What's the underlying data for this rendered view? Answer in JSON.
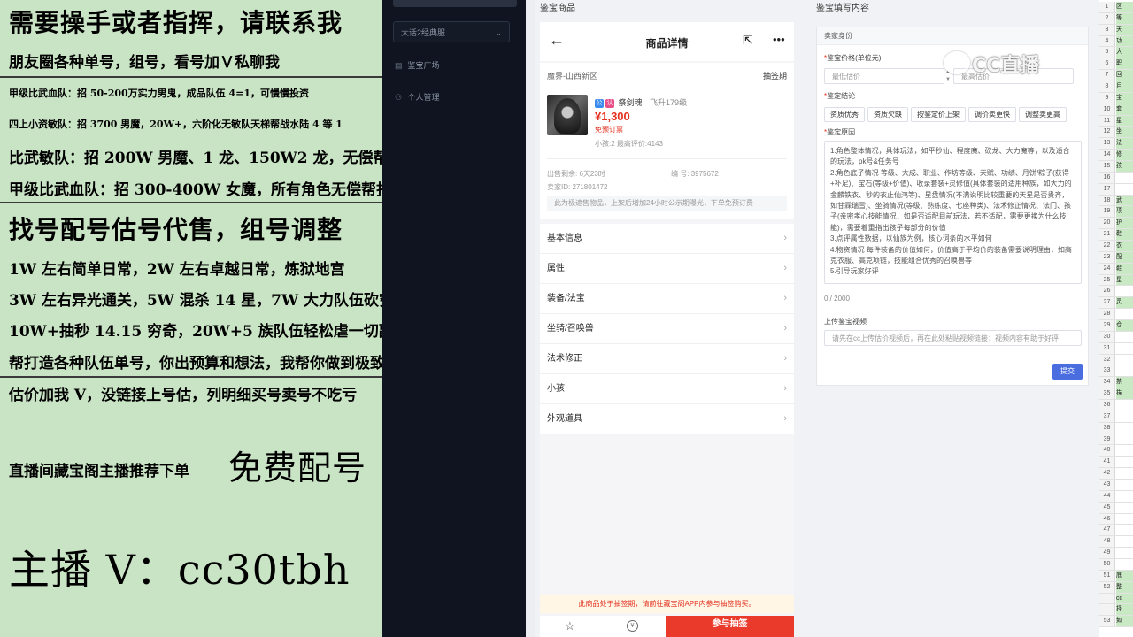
{
  "overlay": {
    "line1": "需要操手或者指挥，请联系我",
    "line2": "朋友圈各种单号，组号，看号加Ｖ私聊我",
    "line3": "甲级比武血队：招 50-200万实力男鬼，成品队伍 4=1，可慢慢投资",
    "line4": "四上小资敏队：招 3700 男魔，20W+，六阶化无敏队天梯帮战水陆 4 等 1",
    "line5": "比武敏队：招 200W 男魔、1 龙、150W2 龙，无偿帮打造",
    "line6": "甲级比武血队：招 300-400W 女魔，所有角色无偿帮打造",
    "line7": "找号配号估号代售，组号调整",
    "line8": "1W 左右简单日常，2W 左右卓越日常，炼狱地宫",
    "line9": "3W 左右异光通关，5W 混杀 14 星，7W 大力队伍砍穷奇",
    "line10": "10W+抽秒 14.15 穷奇，20W+5 族队伍轻松虐一切副本！",
    "line11": "帮打造各种队伍单号，你出预算和想法，我帮你做到极致",
    "line12": "估价加我 V，没链接上号估，列明细买号卖号不吃亏",
    "line13a": "直播间藏宝阁主播推荐下单",
    "line13b": "免费配号",
    "line14": "主播 V：cc30tbh"
  },
  "sidebar": {
    "select_value": "大话2经典服",
    "nav": [
      {
        "icon": "list-icon",
        "label": "鉴宝广场"
      },
      {
        "icon": "user-icon",
        "label": "个人管理"
      }
    ]
  },
  "phone_panel": {
    "title": "鉴宝商品",
    "header_title": "商品详情",
    "server": "魔界-山西新区",
    "lottery_tag": "抽签期",
    "badge1": "公",
    "badge2": "认",
    "char_name": "祭剑魂",
    "char_level": "飞升179级",
    "price": "¥1,300",
    "free_reserve": "免预订票",
    "stats": "小孩:2 最高评价:4143",
    "remain": "出售剩余: 6天23时",
    "serial": "编 号: 3975672",
    "seller": "卖家ID: 271801472",
    "notice": "此为极速售物品，上架后增加24小时公示期曝光，下单免预订费",
    "menu": [
      "基本信息",
      "属性",
      "装备/法宝",
      "坐骑/召唤兽",
      "法术修正",
      "小孩",
      "外观道具"
    ],
    "bottom_notice": "此商品处于抽签期，请前往藏宝阁APP内参与抽签购买。",
    "coin_glyph": "¥",
    "join_label": "参与抽签"
  },
  "form_panel": {
    "title": "鉴宝填写内容",
    "section": "卖家身份",
    "price_label": "鉴宝价格(单位元)",
    "price_min_placeholder": "最低估价",
    "price_max_placeholder": "最高估价",
    "conclusion_label": "鉴定结论",
    "tags": [
      "资质优秀",
      "资质欠缺",
      "按鉴定价上架",
      "调价卖更快",
      "调整卖更高"
    ],
    "reason_label": "鉴定原因",
    "reason_lines": [
      "1.角色整体情况，具体玩法，如平秒仙、程度魔、砍龙、大力魔等，以及适合的玩法，pk号&任务号",
      "2.角色底子情况 等级、大成、职业、作坊等级、天赋、功绩、月饼/粽子(获得+补足)、宝石(等级+价值)、收录套装+灵修值(具体套装的适用种族，如大力的金麟铁衣、秒的衣止仙鸿等)、星盘情况(不满说明比较重要的天星是否贵齐，如甘霖瑞雪)、坐骑情况(等级、熟练度、七座种类)、法术修正情况、法门、孩子(亲密孝心技能情况，如是否适配目前玩法，若不适配，需要更换为什么技能)，需要着重指出孩子每部分的价值",
      "3.点评属性数据，以仙族为例，核心词条的水平如何",
      "4.物资情况 每件装备的价值如何，价值高于平均价的装备需要说明理由，如高克衣服、高克项链，技能组合优秀的召唤兽等",
      "5.引导玩家好评"
    ],
    "counter": "0 / 2000",
    "video_label": "上传鉴宝视频",
    "video_placeholder": "请先在cc上传估价视频后，再在此处粘贴视频链接；视频内容有助于好评",
    "submit": "提交"
  },
  "watermark": "CC直播",
  "sheet": {
    "rows": [
      {
        "n": "1",
        "t": "区"
      },
      {
        "n": "2",
        "t": "等"
      },
      {
        "n": "3",
        "t": "天"
      },
      {
        "n": "4",
        "t": "功"
      },
      {
        "n": "5",
        "t": "大"
      },
      {
        "n": "6",
        "t": "职"
      },
      {
        "n": "7",
        "t": "回"
      },
      {
        "n": "8",
        "t": "月"
      },
      {
        "n": "9",
        "t": "宝"
      },
      {
        "n": "10",
        "t": "套"
      },
      {
        "n": "11",
        "t": "星"
      },
      {
        "n": "12",
        "t": "坐"
      },
      {
        "n": "13",
        "t": "法"
      },
      {
        "n": "14",
        "t": "修"
      },
      {
        "n": "15",
        "t": "孩"
      },
      {
        "n": "16",
        "t": ""
      },
      {
        "n": "17",
        "t": ""
      },
      {
        "n": "18",
        "t": "武"
      },
      {
        "n": "19",
        "t": "项"
      },
      {
        "n": "20",
        "t": "护"
      },
      {
        "n": "21",
        "t": "鞋"
      },
      {
        "n": "22",
        "t": "衣"
      },
      {
        "n": "23",
        "t": "配"
      },
      {
        "n": "24",
        "t": "鞋"
      },
      {
        "n": "25",
        "t": "星"
      },
      {
        "n": "26",
        "t": ""
      },
      {
        "n": "27",
        "t": "灵"
      },
      {
        "n": "28",
        "t": ""
      },
      {
        "n": "29",
        "t": "仓"
      },
      {
        "n": "30",
        "t": ""
      },
      {
        "n": "31",
        "t": ""
      },
      {
        "n": "32",
        "t": ""
      },
      {
        "n": "33",
        "t": ""
      },
      {
        "n": "34",
        "t": "禁"
      },
      {
        "n": "35",
        "t": "描"
      },
      {
        "n": "36",
        "t": ""
      },
      {
        "n": "37",
        "t": ""
      },
      {
        "n": "38",
        "t": ""
      },
      {
        "n": "39",
        "t": ""
      },
      {
        "n": "40",
        "t": ""
      },
      {
        "n": "41",
        "t": ""
      },
      {
        "n": "42",
        "t": ""
      },
      {
        "n": "43",
        "t": ""
      },
      {
        "n": "44",
        "t": ""
      },
      {
        "n": "45",
        "t": ""
      },
      {
        "n": "46",
        "t": ""
      },
      {
        "n": "47",
        "t": ""
      },
      {
        "n": "48",
        "t": ""
      },
      {
        "n": "49",
        "t": ""
      },
      {
        "n": "50",
        "t": ""
      },
      {
        "n": "51",
        "t": "底"
      },
      {
        "n": "52",
        "t": "整"
      },
      {
        "n": "",
        "t": "cc"
      },
      {
        "n": "",
        "t": "择"
      },
      {
        "n": "53",
        "t": "如"
      }
    ],
    "highlight_color": "#c9e8c4"
  }
}
